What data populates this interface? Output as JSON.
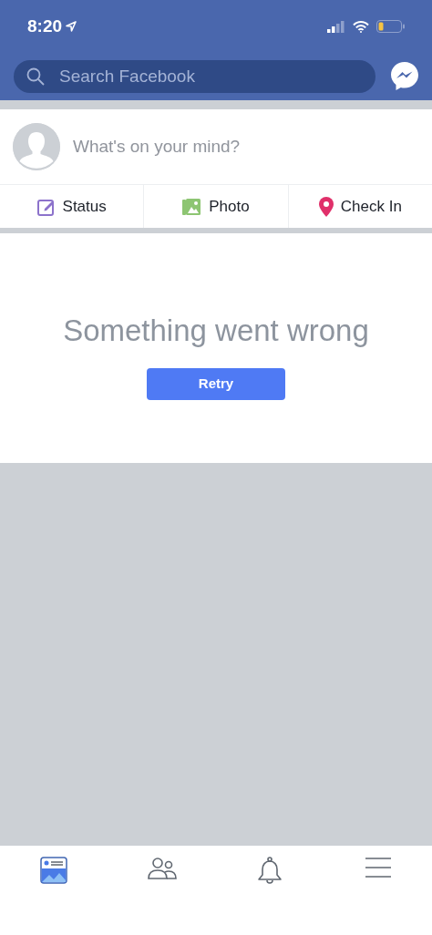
{
  "status_bar": {
    "time": "8:20"
  },
  "search": {
    "placeholder": "Search Facebook"
  },
  "composer": {
    "placeholder": "What's on your mind?"
  },
  "actions": [
    {
      "kind": "status",
      "label": "Status"
    },
    {
      "kind": "photo",
      "label": "Photo"
    },
    {
      "kind": "checkin",
      "label": "Check In"
    }
  ],
  "error": {
    "message": "Something went wrong",
    "button": "Retry"
  },
  "tabs": [
    {
      "kind": "feed",
      "selected": true
    },
    {
      "kind": "friends",
      "selected": false
    },
    {
      "kind": "notifications",
      "selected": false
    },
    {
      "kind": "menu",
      "selected": false
    }
  ]
}
